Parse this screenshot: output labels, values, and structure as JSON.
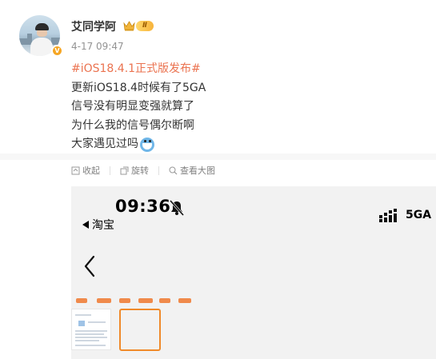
{
  "post": {
    "username": "艾同学阿",
    "level_badge": "Ⅱ",
    "verified_badge": "V",
    "timestamp": "4-17 09:47",
    "topic": "#iOS18.4.1正式版发布#",
    "lines": [
      "更新iOS18.4时候有了5GA",
      "信号没有明显变强就算了",
      "为什么我的信号偶尔断啊",
      "大家遇见过吗"
    ]
  },
  "actions": {
    "collapse": "收起",
    "rotate": "旋转",
    "view_full": "查看大图"
  },
  "screenshot": {
    "time": "09:36",
    "back_app": "淘宝",
    "network": "5GA"
  },
  "colors": {
    "topic": "#eb7350",
    "thumb_selected_border": "#f08a2a",
    "level_badge": "#f7b33b"
  },
  "icons": [
    "crown-icon",
    "verified-icon",
    "collapse-icon",
    "rotate-icon",
    "view-image-icon",
    "bell-slash-icon",
    "signal-icon",
    "chevron-left-icon",
    "emoji-icon"
  ]
}
